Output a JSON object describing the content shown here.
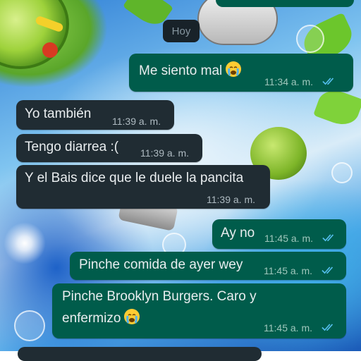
{
  "date_divider": "Hoy",
  "messages": [
    {
      "id": "m1",
      "direction": "out",
      "text": "Me siento mal",
      "emoji": "crying-face",
      "time": "11:34 a. m.",
      "status": "read"
    },
    {
      "id": "m2",
      "direction": "in",
      "text": "Yo también",
      "time": "11:39 a. m."
    },
    {
      "id": "m3",
      "direction": "in",
      "text": "Tengo diarrea :(",
      "time": "11:39 a. m."
    },
    {
      "id": "m4",
      "direction": "in",
      "text": "Y el Bais dice que le duele la pancita",
      "time": "11:39 a. m."
    },
    {
      "id": "m5",
      "direction": "out",
      "text": "Ay no",
      "time": "11:45 a. m.",
      "status": "read"
    },
    {
      "id": "m6",
      "direction": "out",
      "text": "Pinche comida de ayer wey",
      "time": "11:45 a. m.",
      "status": "read"
    },
    {
      "id": "m7",
      "direction": "out",
      "text_line1": "Pinche Brooklyn Burgers. Caro y",
      "text_line2": "enfermizo",
      "emoji": "crying-face",
      "time": "11:45 a. m.",
      "status": "read"
    }
  ],
  "colors": {
    "incoming_bubble": "#202c33",
    "outgoing_bubble": "#005c4b",
    "read_ticks": "#53bdeb",
    "text": "#e9edef"
  }
}
